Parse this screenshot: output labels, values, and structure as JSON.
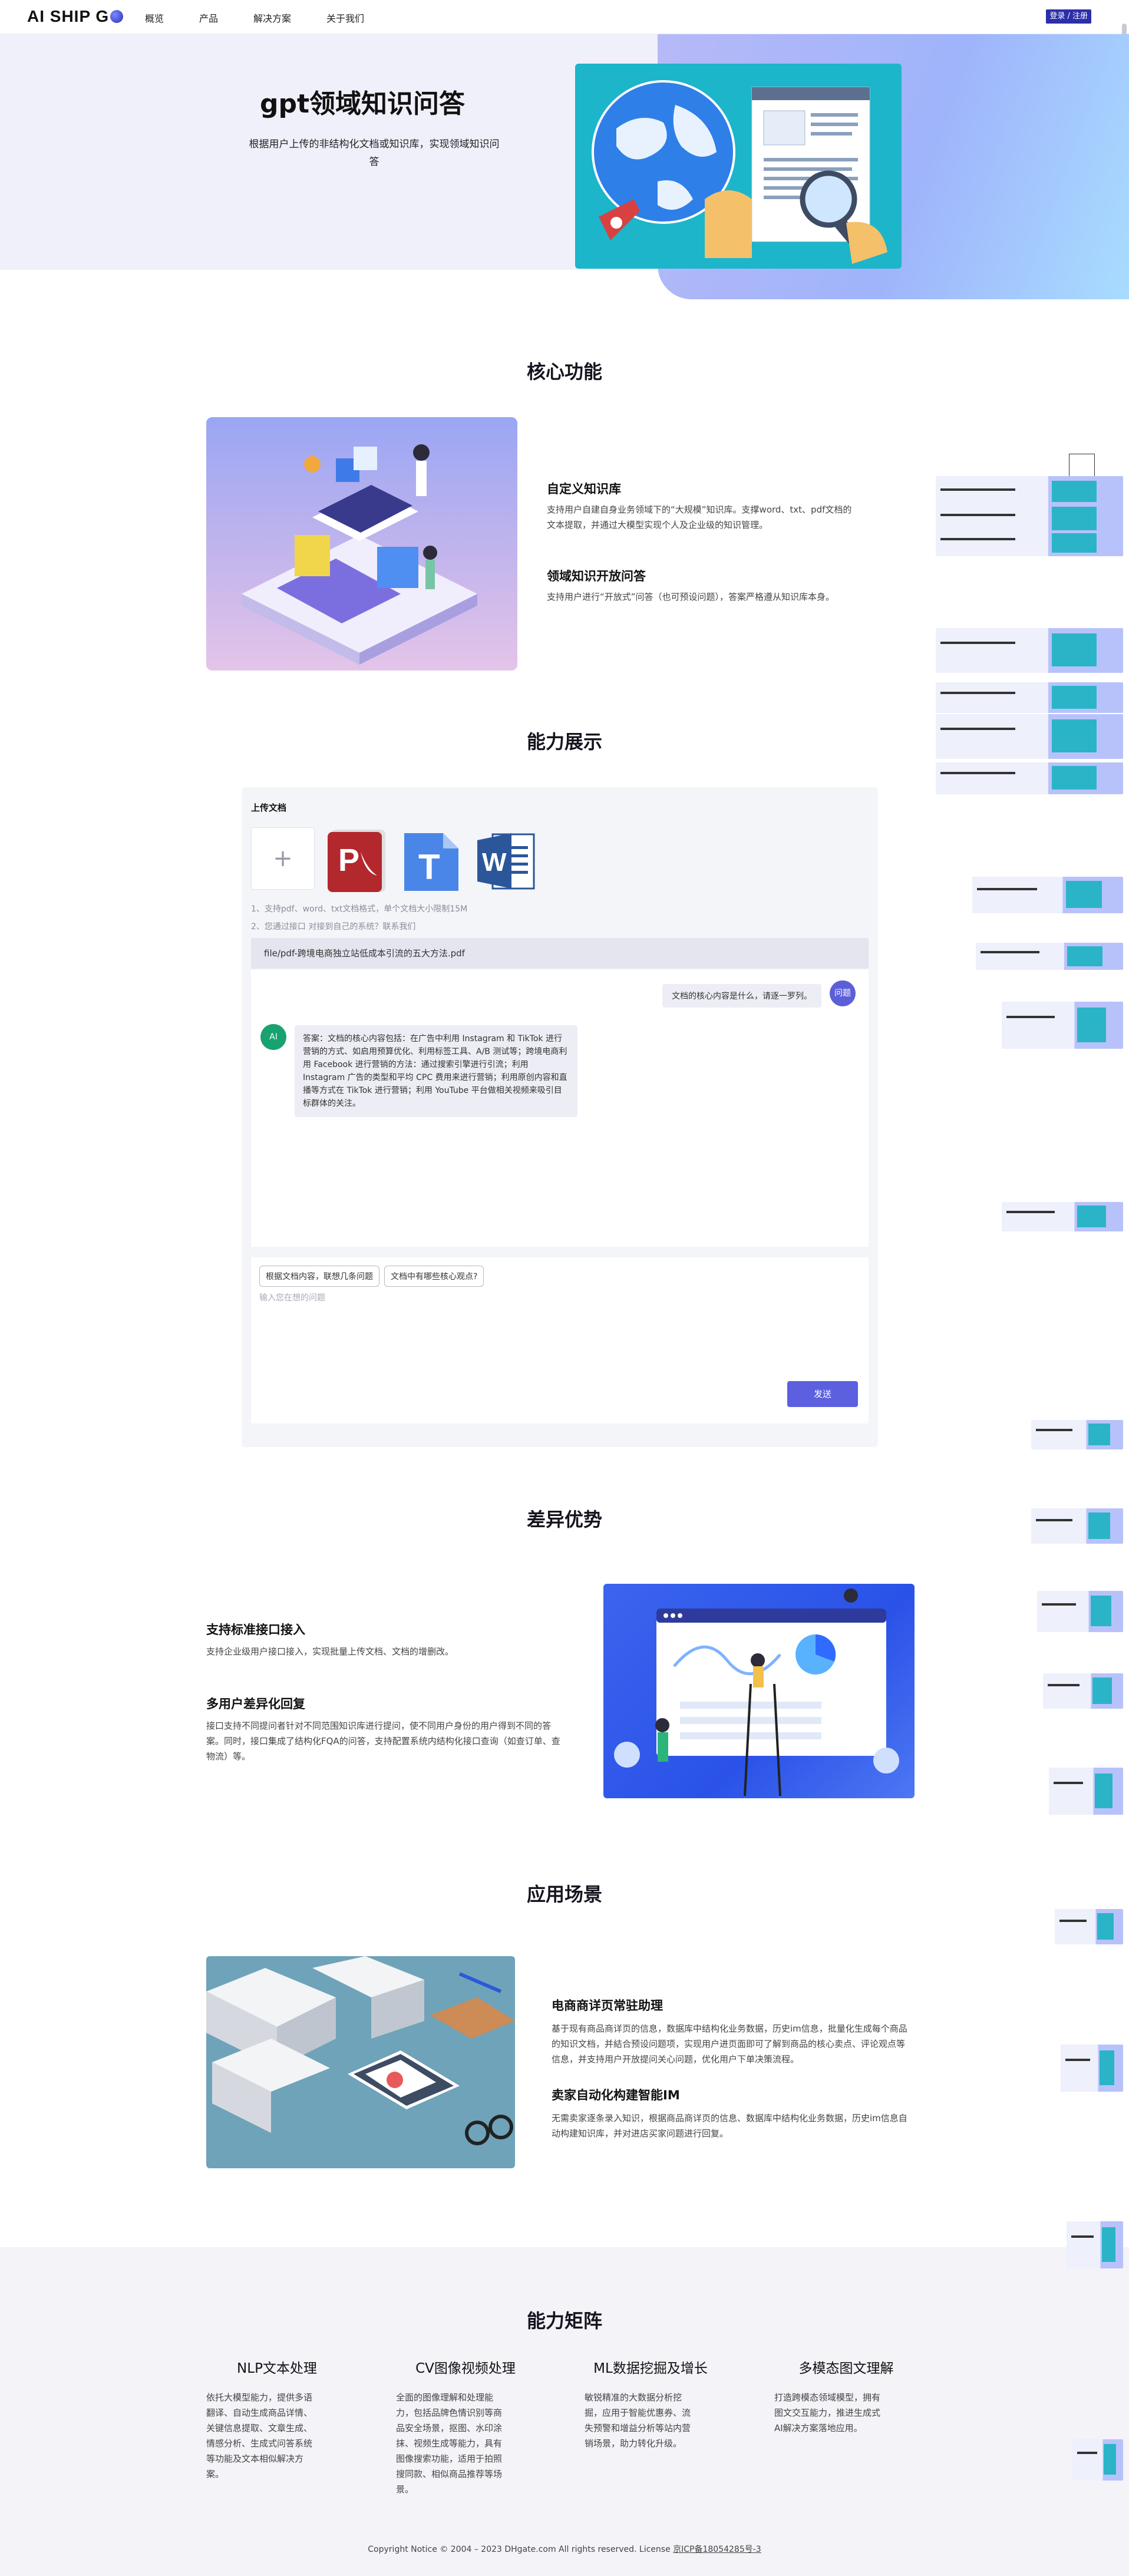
{
  "nav": {
    "logo_text": "AI SHIP G",
    "links": [
      "概览",
      "产品",
      "解决方案",
      "关于我们"
    ],
    "login_label": "登录 / 注册"
  },
  "hero": {
    "title": "gpt领域知识问答",
    "subtitle": "根据用户上传的非结构化文档或知识库，实现领域知识问答"
  },
  "core": {
    "title": "核心功能",
    "features": [
      {
        "title": "自定义知识库",
        "desc": "支持用户自建自身业务领域下的“大规模”知识库。支撑word、txt、pdf文档的文本提取，并通过大模型实现个人及企业级的知识管理。"
      },
      {
        "title": "领域知识开放问答",
        "desc": "支持用户进行“开放式”问答（也可预设问题），答案严格遵从知识库本身。"
      }
    ]
  },
  "demo": {
    "title": "能力展示",
    "upload_label": "上传文档",
    "upload_plus": "+",
    "doc_types": [
      {
        "letter": "P",
        "name": "pdf-icon",
        "color": "#b3282d"
      },
      {
        "letter": "T",
        "name": "txt-icon",
        "color": "#4a86e8"
      },
      {
        "letter": "W",
        "name": "word-icon",
        "color": "#2b579a"
      }
    ],
    "hints": [
      "1、支持pdf、word、txt文档格式，单个文档大小限制15M",
      "2、您通过接口 对接到自己的系统？联系我们"
    ],
    "file_path": "file/pdf-跨境电商独立站低成本引流的五大方法.pdf",
    "question": "文档的核心内容是什么，请逐一罗列。",
    "question_avatar": "问题",
    "answer_avatar": "AI",
    "answer": "答案：文档的核心内容包括：在广告中利用 Instagram 和 TikTok 进行营销的方式、如启用预算优化、利用标签工具、A/B 测试等；跨境电商利用 Facebook 进行营销的方法：通过搜索引擎进行引流；利用 Instagram 广告的类型和平均 CPC 费用来进行营销；利用原创内容和直播等方式在 TikTok 进行营销；利用 YouTube 平台做相关视频来吸引目标群体的关注。",
    "chips": [
      "根据文档内容，联想几条问题",
      "文档中有哪些核心观点?"
    ],
    "input_placeholder": "输入您在想的问题",
    "send_label": "发送"
  },
  "advantages": {
    "title": "差异优势",
    "items": [
      {
        "title": "支持标准接口接入",
        "desc": "支持企业级用户接口接入，实现批量上传文档、文档的增删改。"
      },
      {
        "title": "多用户差异化回复",
        "desc": "接口支持不同提问者针对不同范围知识库进行提问，使不同用户身份的用户得到不同的答案。同时，接口集成了结构化FQA的问答，支持配置系统内结构化接口查询（如查订单、查物流）等。"
      }
    ]
  },
  "scenarios": {
    "title": "应用场景",
    "items": [
      {
        "title": "电商商详页常驻助理",
        "desc": "基于现有商品商详页的信息，数据库中结构化业务数据，历史im信息，批量化生成每个商品的知识文档，并結合预设问题项，实现用户进页面即可了解到商品的核心卖点、评论观点等信息，并支持用户开放提问关心问题，优化用户下单决策流程。"
      },
      {
        "title": "卖家自动化构建智能IM",
        "desc": "无需卖家逐条录入知识，根据商品商详页的信息、数据库中结构化业务数据，历史im信息自动构建知识库，并对进店买家问题进行回复。"
      }
    ]
  },
  "matrix": {
    "title": "能力矩阵",
    "columns": [
      {
        "title": "NLP文本处理",
        "desc": "依托大模型能力，提供多语翻译、自动生成商品详情、关键信息提取、文章生成、情感分析、生成式问答系统等功能及文本相似解决方案。"
      },
      {
        "title": "CV图像视频处理",
        "desc": "全面的图像理解和处理能力，包括品牌色情识别等商品安全场景，抠图、水印涂抹、视频生成等能力，具有图像搜索功能，适用于拍照搜同款、相似商品推荐等场景。"
      },
      {
        "title": "ML数据挖掘及增长",
        "desc": "敏锐精准的大数据分析挖掘，应用于智能优惠券、流失预警和增益分析等站内营销场景，助力转化升级。"
      },
      {
        "title": "多模态图文理解",
        "desc": "打造跨模态领域模型，拥有图文交互能力，推进生成式AI解决方案落地应用。"
      }
    ]
  },
  "footer": {
    "text": "Copyright Notice © 2004 – 2023 DHgate.com All rights reserved. License",
    "icp": "京ICP备18054285号-3"
  }
}
